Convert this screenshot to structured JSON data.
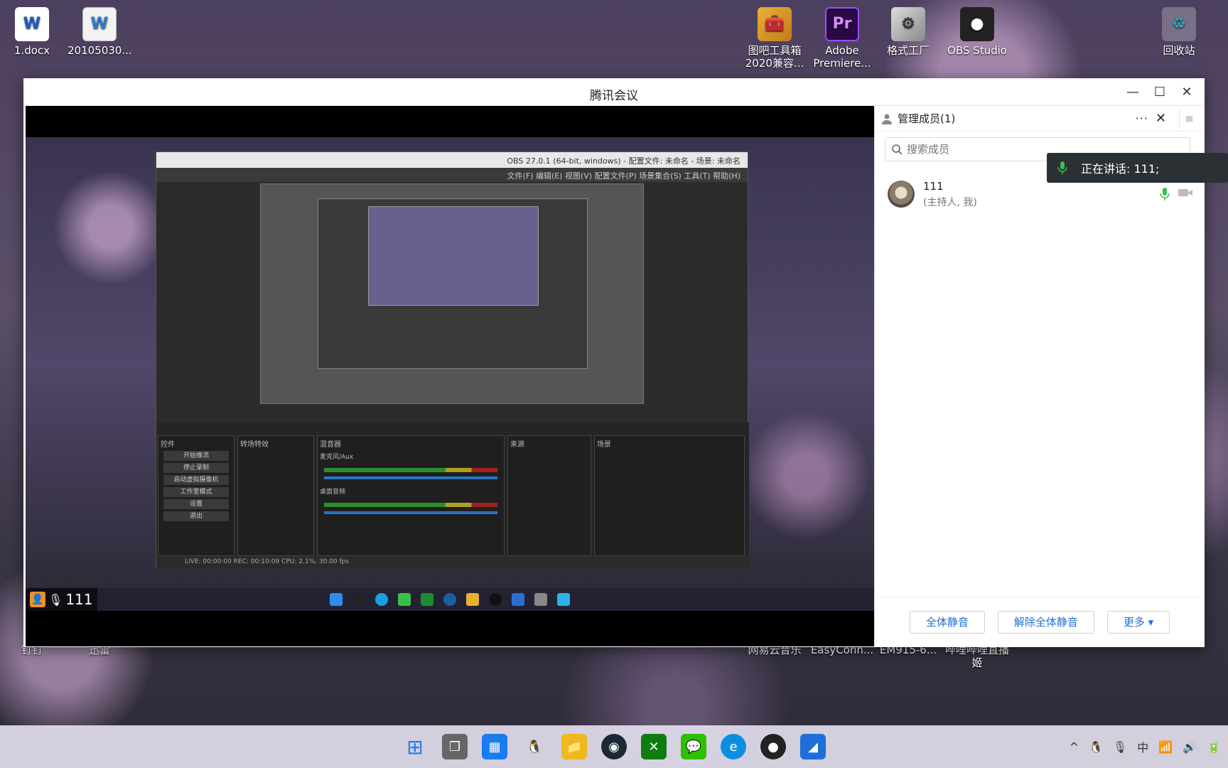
{
  "desktop": {
    "icons_top": [
      {
        "label": "1.docx",
        "glyph": "W"
      },
      {
        "label": "20105030...",
        "glyph": "W"
      }
    ],
    "icons_right": [
      {
        "label": "图吧工具箱 2020兼容...",
        "glyph": "🧰"
      },
      {
        "label": "Adobe Premiere...",
        "glyph": "Pr"
      },
      {
        "label": "格式工厂",
        "glyph": "⚙"
      },
      {
        "label": "OBS Studio",
        "glyph": "●"
      },
      {
        "label": "回收站",
        "glyph": "♻"
      }
    ],
    "icons_bottom": [
      {
        "label": "钉钉",
        "glyph": "钉"
      },
      {
        "label": "迅雷",
        "glyph": "⚡"
      },
      {
        "label": "网易云音乐",
        "glyph": "♫"
      },
      {
        "label": "EasyConn...",
        "glyph": "E"
      },
      {
        "label": "EM915-6...",
        "glyph": "E"
      },
      {
        "label": "哔哩哔哩直播姬",
        "glyph": "B"
      }
    ]
  },
  "window": {
    "title": "腾讯会议"
  },
  "share": {
    "presenter_name": "111",
    "obs_title": "OBS 27.0.1 (64-bit, windows) - 配置文件: 未命名 - 场景: 未命名",
    "obs_menu": "文件(F)  编辑(E)  视图(V)  配置文件(P)  场景集合(S)  工具(T)  帮助(H)",
    "obs_status": "LIVE: 00:00:00   REC: 00:10:09   CPU: 2.1%, 30.00 fps",
    "dock_labels": [
      "场景",
      "来源",
      "混音器",
      "转场特效",
      "控件"
    ],
    "controls": [
      "开始推流",
      "停止录制",
      "启动虚拟摄像机",
      "工作室模式",
      "设置",
      "退出"
    ],
    "mixer_items": [
      "桌面音频",
      "麦克风/Aux"
    ]
  },
  "panel": {
    "header": "管理成员(1)",
    "search_placeholder": "搜索成员",
    "member_name": "111",
    "member_role": "(主持人, 我)",
    "speaking": "正在讲话: 111;",
    "buttons": {
      "mute_all": "全体静音",
      "unmute_all": "解除全体静音",
      "more": "更多 ▾"
    }
  },
  "colors": {
    "accent": "#1e6fd9",
    "mic_green": "#3cbf4a"
  }
}
